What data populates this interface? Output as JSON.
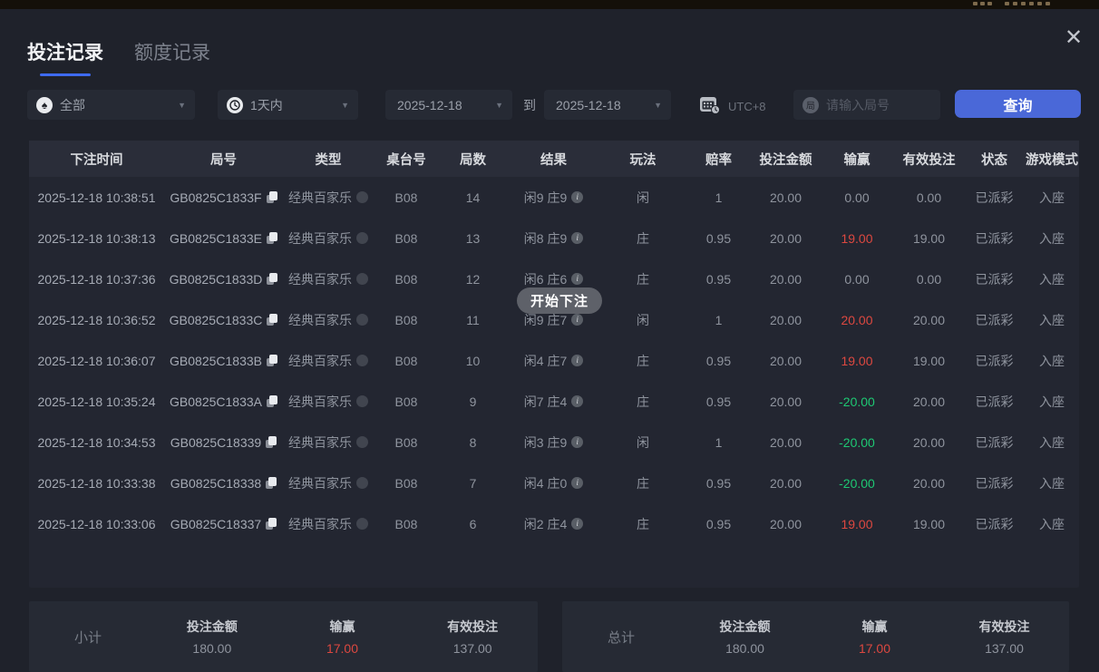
{
  "colors": {
    "accent_blue": "#4a68d8",
    "win_red": "#dd4840",
    "loss_green": "#1ec873",
    "tab_underline": "#3e6af0"
  },
  "window": {
    "close_icon": "✕"
  },
  "tabs": {
    "bet_records": "投注记录",
    "quota_records": "额度记录"
  },
  "filters": {
    "game_type_value": "全部",
    "time_range_value": "1天内",
    "date_from": "2025-12-18",
    "to_label": "到",
    "date_to": "2025-12-18",
    "timezone": "UTC+8",
    "round_input_placeholder": "请输入局号",
    "round_input_icon_char": "局",
    "search_button": "查询"
  },
  "toast": "开始下注",
  "table": {
    "columns": [
      "下注时间",
      "局号",
      "类型",
      "桌台号",
      "局数",
      "结果",
      "玩法",
      "赔率",
      "投注金额",
      "输赢",
      "有效投注",
      "状态",
      "游戏模式"
    ],
    "info_icon_char": "i",
    "rows": [
      {
        "time": "2025-12-18 10:38:51",
        "round": "GB0825C1833F",
        "type": "经典百家乐",
        "table": "B08",
        "games": "14",
        "result": "闲9 庄9",
        "play": "闲",
        "odds": "1",
        "bet": "20.00",
        "winloss": "0.00",
        "valid": "0.00",
        "status": "已派彩",
        "mode": "入座"
      },
      {
        "time": "2025-12-18 10:38:13",
        "round": "GB0825C1833E",
        "type": "经典百家乐",
        "table": "B08",
        "games": "13",
        "result": "闲8 庄9",
        "play": "庄",
        "odds": "0.95",
        "bet": "20.00",
        "winloss": "19.00",
        "valid": "19.00",
        "status": "已派彩",
        "mode": "入座"
      },
      {
        "time": "2025-12-18 10:37:36",
        "round": "GB0825C1833D",
        "type": "经典百家乐",
        "table": "B08",
        "games": "12",
        "result": "闲6 庄6",
        "play": "庄",
        "odds": "0.95",
        "bet": "20.00",
        "winloss": "0.00",
        "valid": "0.00",
        "status": "已派彩",
        "mode": "入座"
      },
      {
        "time": "2025-12-18 10:36:52",
        "round": "GB0825C1833C",
        "type": "经典百家乐",
        "table": "B08",
        "games": "11",
        "result": "闲9 庄7",
        "play": "闲",
        "odds": "1",
        "bet": "20.00",
        "winloss": "20.00",
        "valid": "20.00",
        "status": "已派彩",
        "mode": "入座"
      },
      {
        "time": "2025-12-18 10:36:07",
        "round": "GB0825C1833B",
        "type": "经典百家乐",
        "table": "B08",
        "games": "10",
        "result": "闲4 庄7",
        "play": "庄",
        "odds": "0.95",
        "bet": "20.00",
        "winloss": "19.00",
        "valid": "19.00",
        "status": "已派彩",
        "mode": "入座"
      },
      {
        "time": "2025-12-18 10:35:24",
        "round": "GB0825C1833A",
        "type": "经典百家乐",
        "table": "B08",
        "games": "9",
        "result": "闲7 庄4",
        "play": "庄",
        "odds": "0.95",
        "bet": "20.00",
        "winloss": "-20.00",
        "valid": "20.00",
        "status": "已派彩",
        "mode": "入座"
      },
      {
        "time": "2025-12-18 10:34:53",
        "round": "GB0825C18339",
        "type": "经典百家乐",
        "table": "B08",
        "games": "8",
        "result": "闲3 庄9",
        "play": "闲",
        "odds": "1",
        "bet": "20.00",
        "winloss": "-20.00",
        "valid": "20.00",
        "status": "已派彩",
        "mode": "入座"
      },
      {
        "time": "2025-12-18 10:33:38",
        "round": "GB0825C18338",
        "type": "经典百家乐",
        "table": "B08",
        "games": "7",
        "result": "闲4 庄0",
        "play": "庄",
        "odds": "0.95",
        "bet": "20.00",
        "winloss": "-20.00",
        "valid": "20.00",
        "status": "已派彩",
        "mode": "入座"
      },
      {
        "time": "2025-12-18 10:33:06",
        "round": "GB0825C18337",
        "type": "经典百家乐",
        "table": "B08",
        "games": "6",
        "result": "闲2 庄4",
        "play": "庄",
        "odds": "0.95",
        "bet": "20.00",
        "winloss": "19.00",
        "valid": "19.00",
        "status": "已派彩",
        "mode": "入座"
      }
    ]
  },
  "summary": {
    "subtotal": {
      "label": "小计",
      "bet_label": "投注金额",
      "bet": "180.00",
      "winloss_label": "输赢",
      "winloss": "17.00",
      "valid_label": "有效投注",
      "valid": "137.00"
    },
    "total": {
      "label": "总计",
      "bet_label": "投注金额",
      "bet": "180.00",
      "winloss_label": "输赢",
      "winloss": "17.00",
      "valid_label": "有效投注",
      "valid": "137.00"
    }
  }
}
